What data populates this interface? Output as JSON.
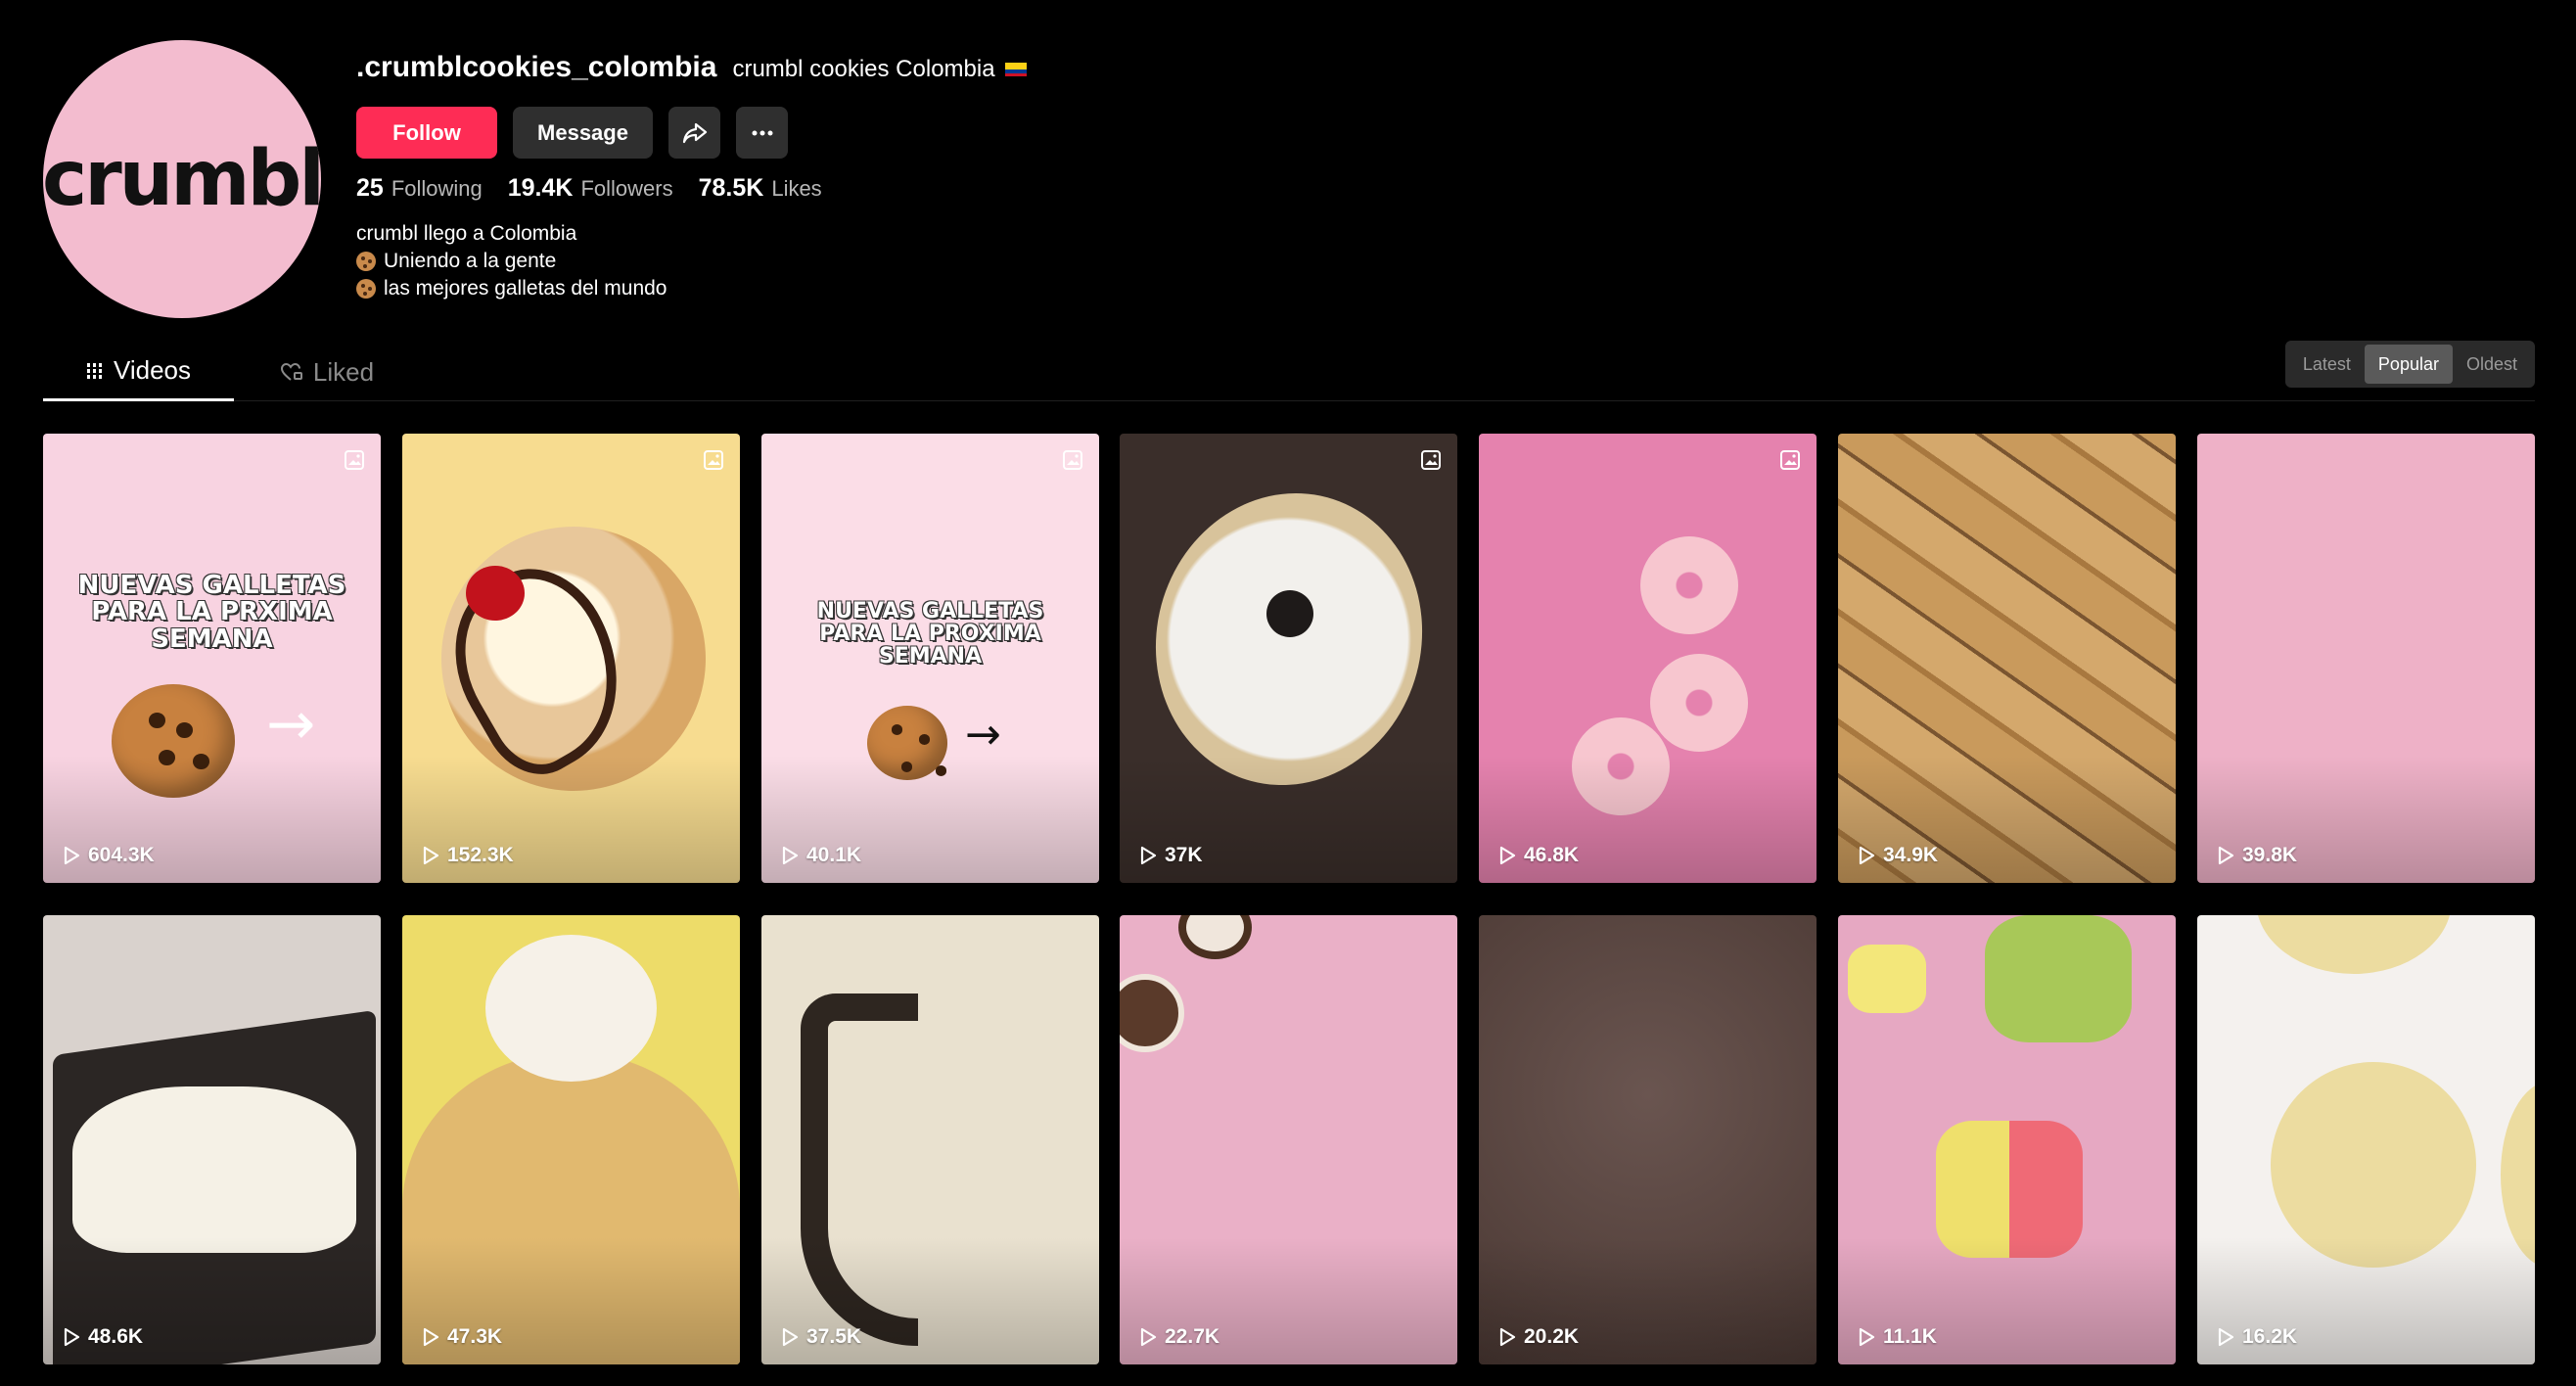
{
  "profile": {
    "username": ".crumblcookies_colombia",
    "nickname": "crumbl cookies Colombia",
    "avatar_text": "crumbl",
    "buttons": {
      "follow": "Follow",
      "message": "Message"
    },
    "stats": [
      {
        "value": "25",
        "label": "Following"
      },
      {
        "value": "19.4K",
        "label": "Followers"
      },
      {
        "value": "78.5K",
        "label": "Likes"
      }
    ],
    "bio": [
      "crumbl llego a Colombia",
      "Uniendo a la gente",
      " las mejores galletas del mundo"
    ]
  },
  "tabs": {
    "videos": "Videos",
    "liked": "Liked"
  },
  "sort": {
    "options": [
      "Latest",
      "Popular",
      "Oldest"
    ],
    "selected": "Popular"
  },
  "videos": [
    {
      "views": "604.3K",
      "overlay": "NUEVAS GALLETAS PARA LA PRXIMA SEMANA",
      "gallery": true
    },
    {
      "views": "152.3K",
      "gallery": true
    },
    {
      "views": "40.1K",
      "overlay": "NUEVAS GALLETAS PARA LA PROXIMA SEMANA",
      "gallery": true
    },
    {
      "views": "37K",
      "gallery": true
    },
    {
      "views": "46.8K",
      "gallery": true
    },
    {
      "views": "34.9K"
    },
    {
      "views": "39.8K"
    },
    {
      "views": "48.6K"
    },
    {
      "views": "47.3K"
    },
    {
      "views": "37.5K"
    },
    {
      "views": "22.7K"
    },
    {
      "views": "20.2K"
    },
    {
      "views": "11.1K"
    },
    {
      "views": "16.2K"
    }
  ],
  "colors": {
    "follow": "#fe2c55",
    "background": "#000000",
    "avatar_bg": "#f3bccf"
  }
}
